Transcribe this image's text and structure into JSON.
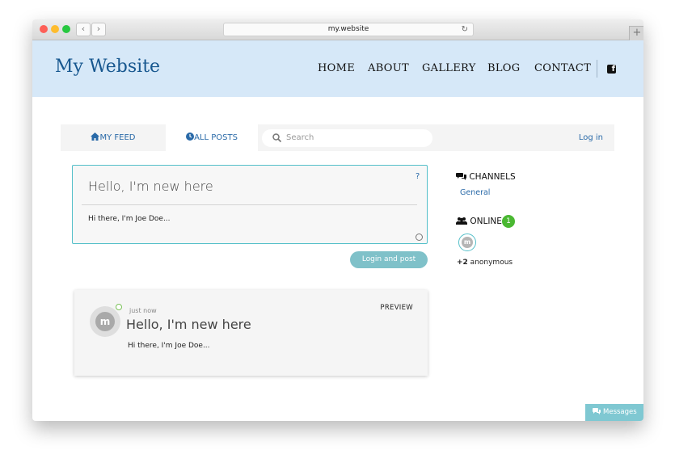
{
  "browser": {
    "url": "my.website",
    "back_label": "‹",
    "forward_label": "›",
    "reload_icon": "↻",
    "new_tab_icon": "+",
    "traffic_colors": {
      "close": "#fd5f57",
      "minimize": "#febc2e",
      "zoom": "#28c840"
    }
  },
  "header": {
    "site_title": "My Website",
    "nav": [
      "HOME",
      "ABOUT",
      "GALLERY",
      "BLOG",
      "CONTACT"
    ],
    "social_icon": "facebook-icon"
  },
  "tabs": {
    "my_feed": "MY FEED",
    "all_posts": "ALL POSTS"
  },
  "search": {
    "placeholder": "Search"
  },
  "auth": {
    "login": "Log in"
  },
  "composer": {
    "title": "Hello, I'm new here",
    "body": "Hi there, I'm Joe Doe...",
    "help": "?",
    "submit": "Login and post"
  },
  "post": {
    "avatar_letter": "m",
    "timestamp": "just now",
    "title": "Hello, I'm new here",
    "body": "Hi there, I'm Joe Doe...",
    "preview_label": "PREVIEW"
  },
  "sidebar": {
    "channels_title": "CHANNELS",
    "channels": [
      "General"
    ],
    "online_title": "ONLINE",
    "online_count": "1",
    "anonymous_count": "+2",
    "anonymous_label": " anonymous",
    "avatar_letter": "m"
  },
  "messages_button": "Messages",
  "colors": {
    "accent": "#2a6aa8",
    "header_bg": "#d6e8f8",
    "teal": "#54bfc9",
    "online": "#4ab832"
  }
}
